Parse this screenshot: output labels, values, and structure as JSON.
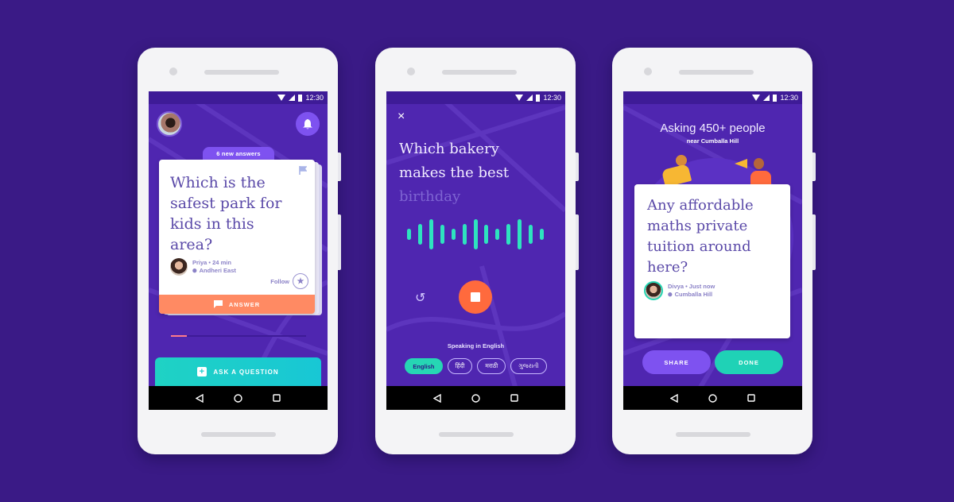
{
  "colors": {
    "background": "#3a1a86",
    "screen_purple": "#4f26b0",
    "accent_purple": "#7e52f0",
    "teal": "#1fd2c4",
    "orange": "#ff8a63",
    "stop_red": "#ff6a3d"
  },
  "status_bar": {
    "time": "12:30",
    "icons": [
      "wifi-icon",
      "signal-icon",
      "battery-icon"
    ]
  },
  "nav_bar": {
    "icons": [
      "back-icon",
      "home-icon",
      "recents-icon"
    ]
  },
  "phone1": {
    "new_answers_badge": "6 new answers",
    "question": "Which is the safest park for kids in this area?",
    "author": {
      "name_time": "Priya • 24 min",
      "location": "Andheri East"
    },
    "follow_label": "Follow",
    "answer_label": "ANSWER",
    "progress": 0.12,
    "ask_label": "ASK A QUESTION"
  },
  "phone2": {
    "question_spoken": "Which bakery makes the best",
    "question_pending": "birthday",
    "wave_levels": [
      0.35,
      0.65,
      0.95,
      0.6,
      0.35,
      0.65,
      0.95,
      0.6,
      0.35,
      0.65,
      0.95,
      0.6,
      0.35
    ],
    "speaking_label": "Speaking in English",
    "languages": [
      {
        "label": "English",
        "active": true
      },
      {
        "label": "हिंदी",
        "active": false
      },
      {
        "label": "मराठी",
        "active": false
      },
      {
        "label": "ગુજરાતી",
        "active": false
      }
    ]
  },
  "phone3": {
    "title": "Asking 450+ people",
    "subtitle": "near Cumballa Hill",
    "question": "Any affordable maths private tuition around here?",
    "author": {
      "name_time": "Divya • Just now",
      "location": "Cumballa Hill"
    },
    "share_label": "SHARE",
    "done_label": "DONE"
  }
}
